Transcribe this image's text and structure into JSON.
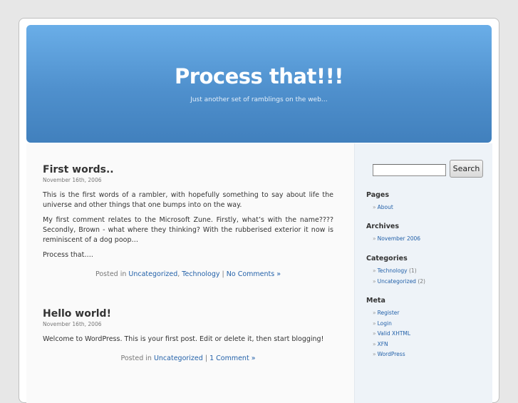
{
  "header": {
    "title": "Process that!!!",
    "tagline": "Just another set of ramblings on the web…"
  },
  "posts": [
    {
      "title": "First words..",
      "date": "November 16th, 2006",
      "paragraphs": [
        "This is the first words of a rambler, with hopefully something to say about life the universe and other things that one bumps into on the way.",
        "My first comment relates to the Microsoft Zune. Firstly, what’s with the name???? Secondly, Brown - what where they thinking? With the rubberised exterior it now is reminiscent of a dog poop…",
        "Process that…."
      ],
      "posted_in": "Posted in",
      "categories": [
        "Uncategorized",
        "Technology"
      ],
      "separator": "|",
      "comments": "No Comments »"
    },
    {
      "title": "Hello world!",
      "date": "November 16th, 2006",
      "paragraphs": [
        "Welcome to WordPress. This is your first post. Edit or delete it, then start blogging!"
      ],
      "posted_in": "Posted in",
      "categories": [
        "Uncategorized"
      ],
      "separator": "|",
      "comments": "1 Comment »"
    }
  ],
  "sidebar": {
    "search": {
      "value": "",
      "button_label": "Search"
    },
    "raquo": "»",
    "pages": {
      "heading": "Pages",
      "items": [
        {
          "label": "About"
        }
      ]
    },
    "archives": {
      "heading": "Archives",
      "items": [
        {
          "label": "November 2006"
        }
      ]
    },
    "categories": {
      "heading": "Categories",
      "items": [
        {
          "label": "Technology",
          "count": "(1)"
        },
        {
          "label": "Uncategorized",
          "count": "(2)"
        }
      ]
    },
    "meta": {
      "heading": "Meta",
      "items": [
        {
          "label": "Register"
        },
        {
          "label": "Login"
        },
        {
          "label": "Valid XHTML"
        },
        {
          "label": "XFN"
        },
        {
          "label": "WordPress"
        }
      ]
    }
  },
  "colors": {
    "header_top": "#6aaee8",
    "header_bottom": "#4180bd",
    "link": "#2361a9",
    "sidebar_bg": "#eef3f8"
  }
}
